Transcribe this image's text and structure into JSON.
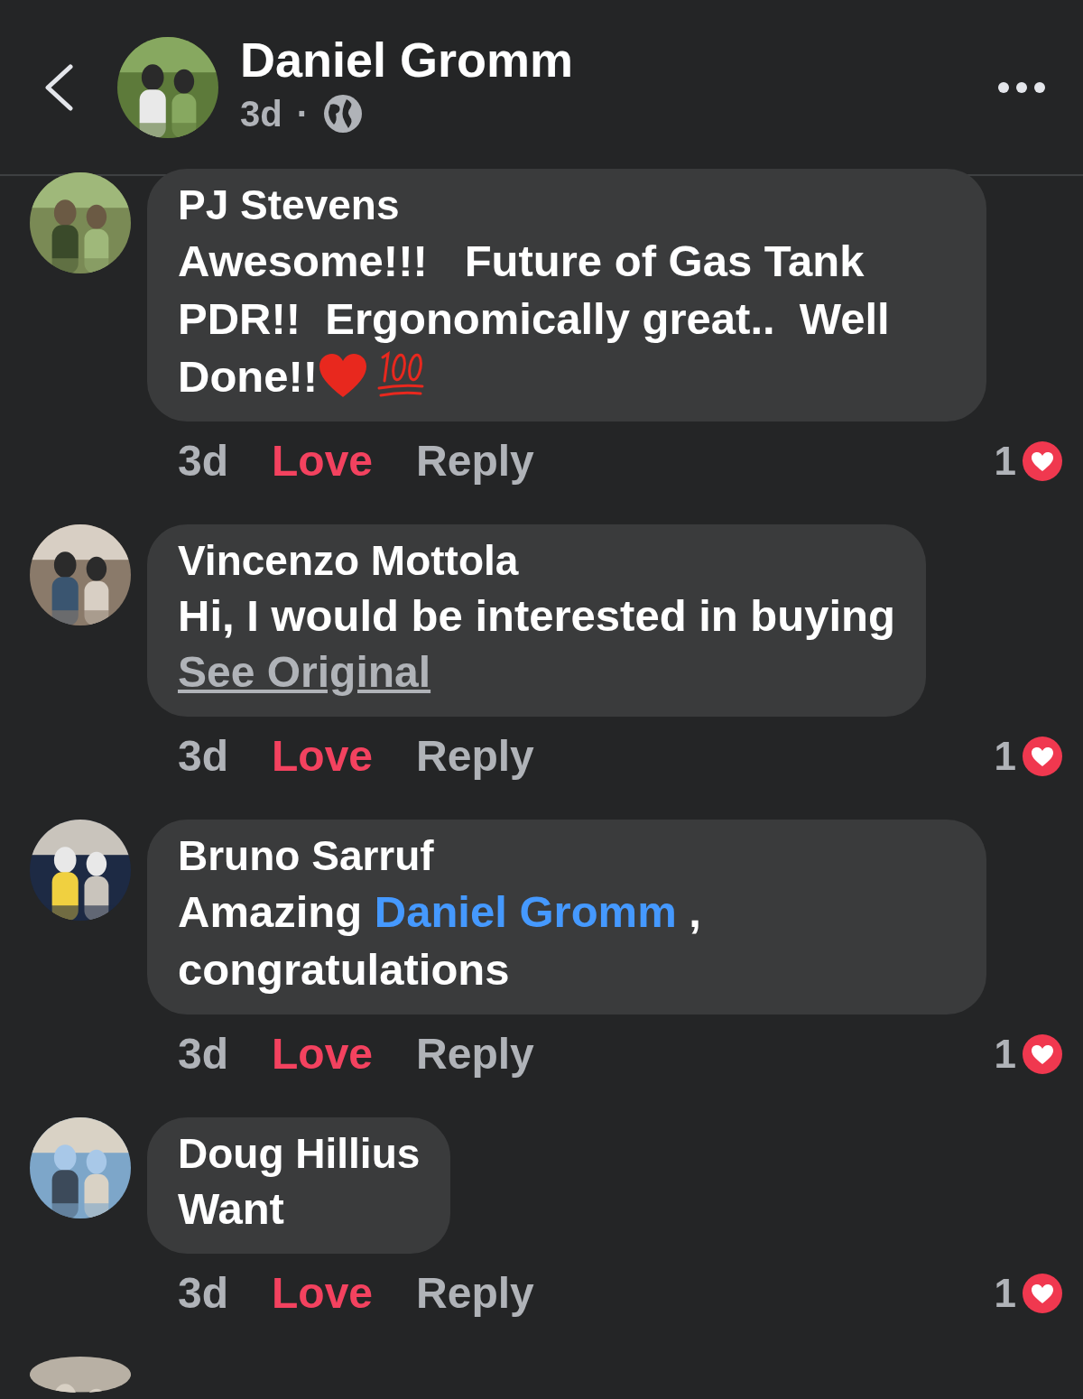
{
  "header": {
    "author": "Daniel Gromm",
    "time": "3d",
    "separator": "·"
  },
  "comments": [
    {
      "author": "PJ Stevens",
      "body": [
        {
          "kind": "text",
          "text": "Awesome!!!   Future of Gas Tank PDR!!  Ergonomically great..  Well Done!!"
        },
        {
          "kind": "heart_emoji"
        },
        {
          "kind": "hundred_emoji"
        }
      ],
      "time": "3d",
      "reaction_label": "Love",
      "reacted": true,
      "reply": "Reply",
      "reaction_count": "1"
    },
    {
      "author": "Vincenzo Mottola",
      "body": [
        {
          "kind": "text",
          "text": "Hi, I would be interested in buying"
        }
      ],
      "see_original": "See Original",
      "time": "3d",
      "reaction_label": "Love",
      "reacted": true,
      "reply": "Reply",
      "reaction_count": "1"
    },
    {
      "author": "Bruno Sarruf",
      "body": [
        {
          "kind": "text",
          "text": "Amazing "
        },
        {
          "kind": "mention",
          "text": "Daniel Gromm"
        },
        {
          "kind": "text",
          "text": " , congratulations"
        }
      ],
      "time": "3d",
      "reaction_label": "Love",
      "reacted": true,
      "reply": "Reply",
      "reaction_count": "1"
    },
    {
      "author": "Doug Hillius",
      "body": [
        {
          "kind": "text",
          "text": "Want"
        }
      ],
      "time": "3d",
      "reaction_label": "Love",
      "reacted": true,
      "reply": "Reply",
      "reaction_count": "1"
    }
  ]
}
